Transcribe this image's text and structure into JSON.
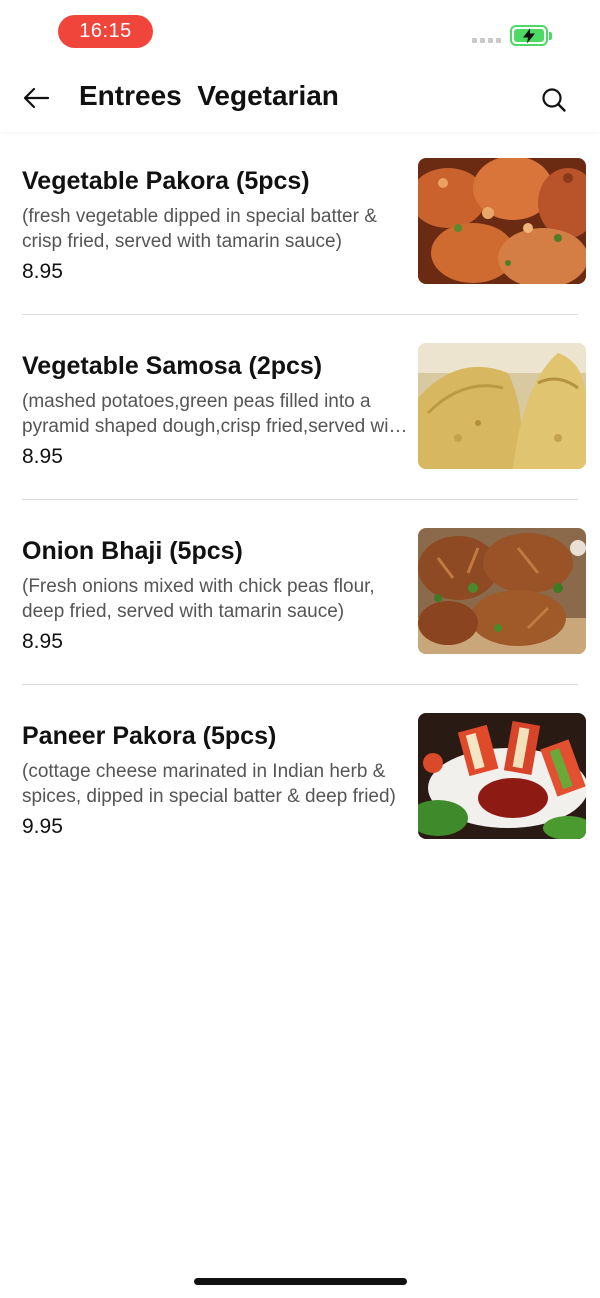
{
  "status": {
    "time": "16:15",
    "battery_color": "#4cd964",
    "time_pill_color": "#f0453a"
  },
  "header": {
    "title": "Entrees  Vegetarian",
    "back_icon": "arrow-left-icon",
    "search_icon": "search-icon"
  },
  "items": [
    {
      "name": "Vegetable Pakora (5pcs)",
      "description": "(fresh vegetable dipped in special batter & crisp fried, served with tamarin sauce)",
      "price": "8.95",
      "image": "vegetable-pakora-photo"
    },
    {
      "name": "Vegetable Samosa (2pcs)",
      "description": "(mashed potatoes,green peas filled into a pyramid shaped dough,crisp fried,served with tamarin sauce)",
      "price": "8.95",
      "image": "vegetable-samosa-photo"
    },
    {
      "name": "Onion Bhaji (5pcs)",
      "description": "(Fresh onions mixed with chick peas flour, deep fried, served with tamarin sauce)",
      "price": "8.95",
      "image": "onion-bhaji-photo"
    },
    {
      "name": "Paneer Pakora (5pcs)",
      "description": "(cottage cheese marinated in Indian herb & spices, dipped in special batter & deep fried)",
      "price": "9.95",
      "image": "paneer-pakora-photo"
    }
  ]
}
